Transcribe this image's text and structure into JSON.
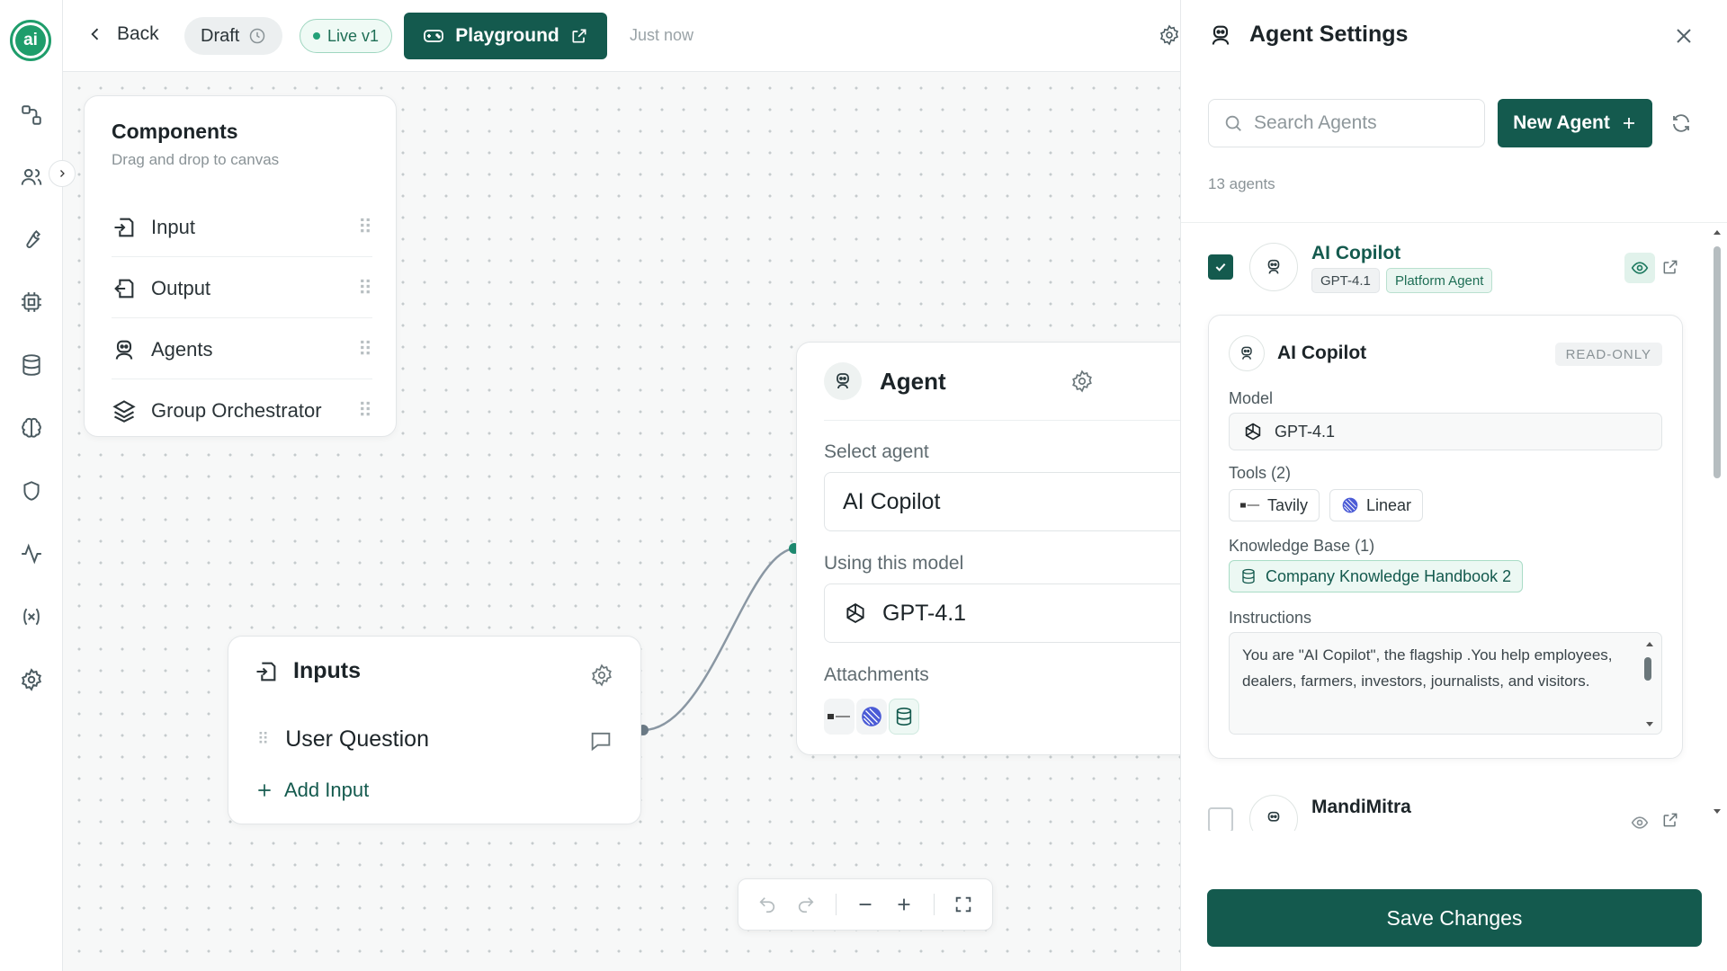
{
  "app": {
    "logo_text": "ai"
  },
  "toolbar": {
    "back_label": "Back",
    "draft_label": "Draft",
    "live_label": "Live v1",
    "playground_label": "Playground",
    "status_text": "Just now"
  },
  "components": {
    "title": "Components",
    "subtitle": "Drag and drop to canvas",
    "items": [
      {
        "label": "Input",
        "icon": "input-icon"
      },
      {
        "label": "Output",
        "icon": "output-icon"
      },
      {
        "label": "Agents",
        "icon": "agent-icon"
      },
      {
        "label": "Group Orchestrator",
        "icon": "layers-icon"
      }
    ]
  },
  "agent_node": {
    "title": "Agent",
    "select_label": "Select agent",
    "selected_agent": "AI Copilot",
    "model_label": "Using this model",
    "model": "GPT-4.1",
    "attachments_label": "Attachments",
    "attachments": [
      "tavily-icon",
      "linear-icon",
      "database-icon"
    ]
  },
  "inputs_node": {
    "title": "Inputs",
    "fields": [
      "User Question"
    ],
    "add_label": "Add Input"
  },
  "zoom_controls": [
    "undo-icon",
    "redo-icon",
    "zoom-out-icon",
    "zoom-in-icon",
    "fit-view-icon"
  ],
  "panel": {
    "title": "Agent Settings",
    "search_placeholder": "Search Agents",
    "new_agent_label": "New Agent",
    "count_text": "13 agents",
    "agents": [
      {
        "name": "AI Copilot",
        "checked": true,
        "tags": [
          "GPT-4.1",
          "Platform Agent"
        ]
      },
      {
        "name": "MandiMitra",
        "checked": false,
        "tags": []
      }
    ],
    "detail": {
      "name": "AI Copilot",
      "badge": "READ-ONLY",
      "model_label": "Model",
      "model": "GPT-4.1",
      "tools_label": "Tools (2)",
      "tools": [
        "Tavily",
        "Linear"
      ],
      "kb_label": "Knowledge Base (1)",
      "kb": [
        "Company Knowledge Handbook 2"
      ],
      "instructions_label": "Instructions",
      "instructions": "You are \"AI Copilot\", the flagship .You help employees, dealers, farmers, investors, journalists, and visitors."
    },
    "save_label": "Save Changes"
  },
  "colors": {
    "brand": "#145a4e",
    "accent": "#1f9d6b"
  }
}
